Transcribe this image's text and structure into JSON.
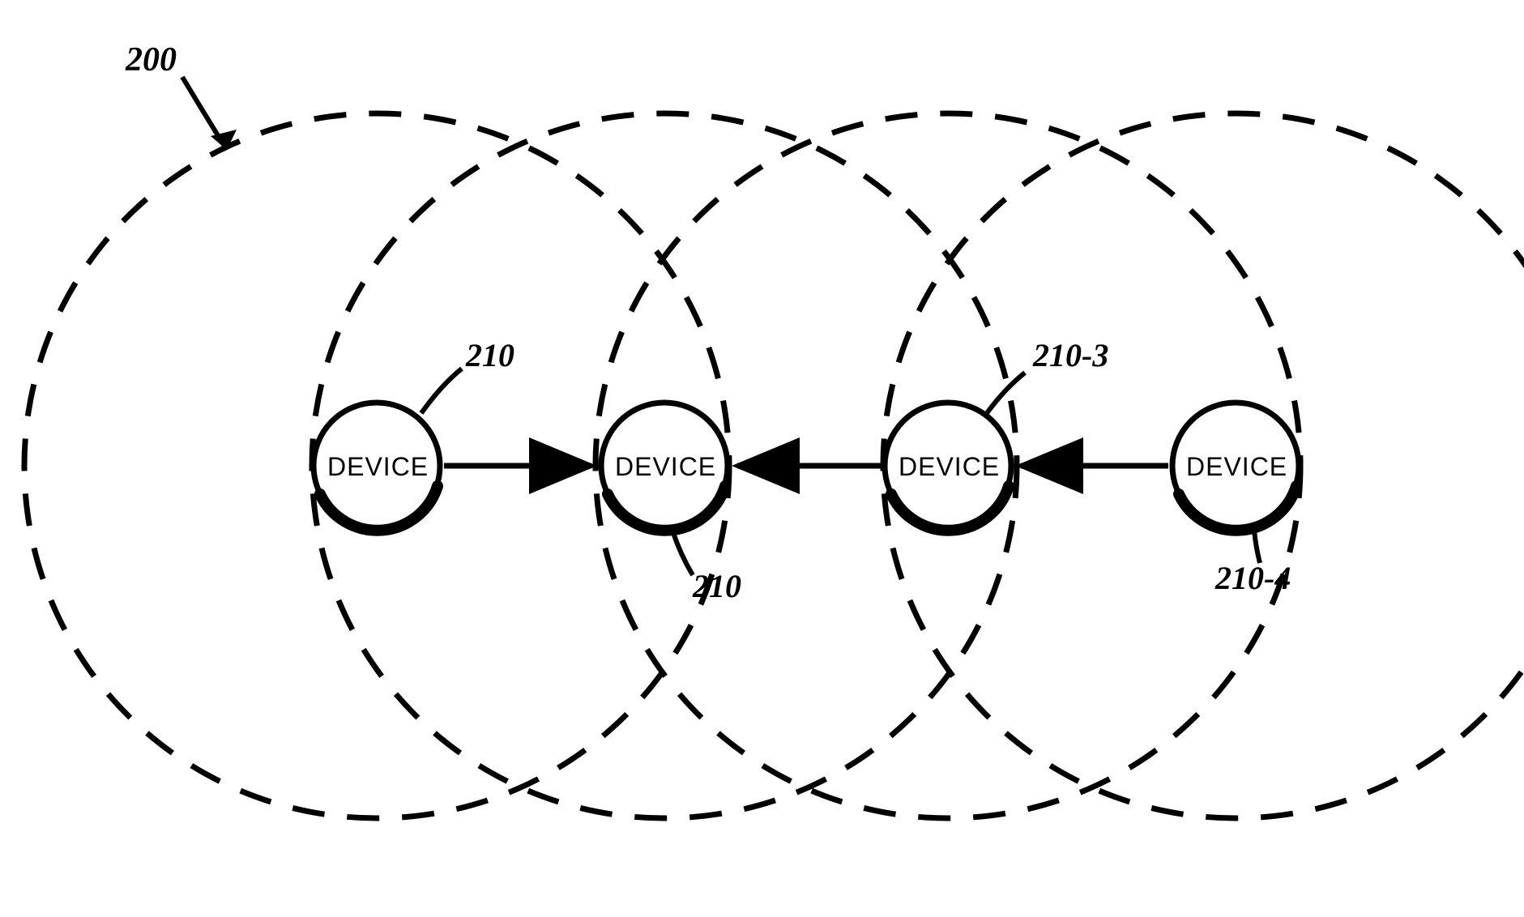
{
  "figure_ref": "200",
  "devices": [
    {
      "label": "DEVICE",
      "ref": "210"
    },
    {
      "label": "DEVICE",
      "ref": "210"
    },
    {
      "label": "DEVICE",
      "ref": "210-3"
    },
    {
      "label": "DEVICE",
      "ref": "210-4"
    }
  ]
}
